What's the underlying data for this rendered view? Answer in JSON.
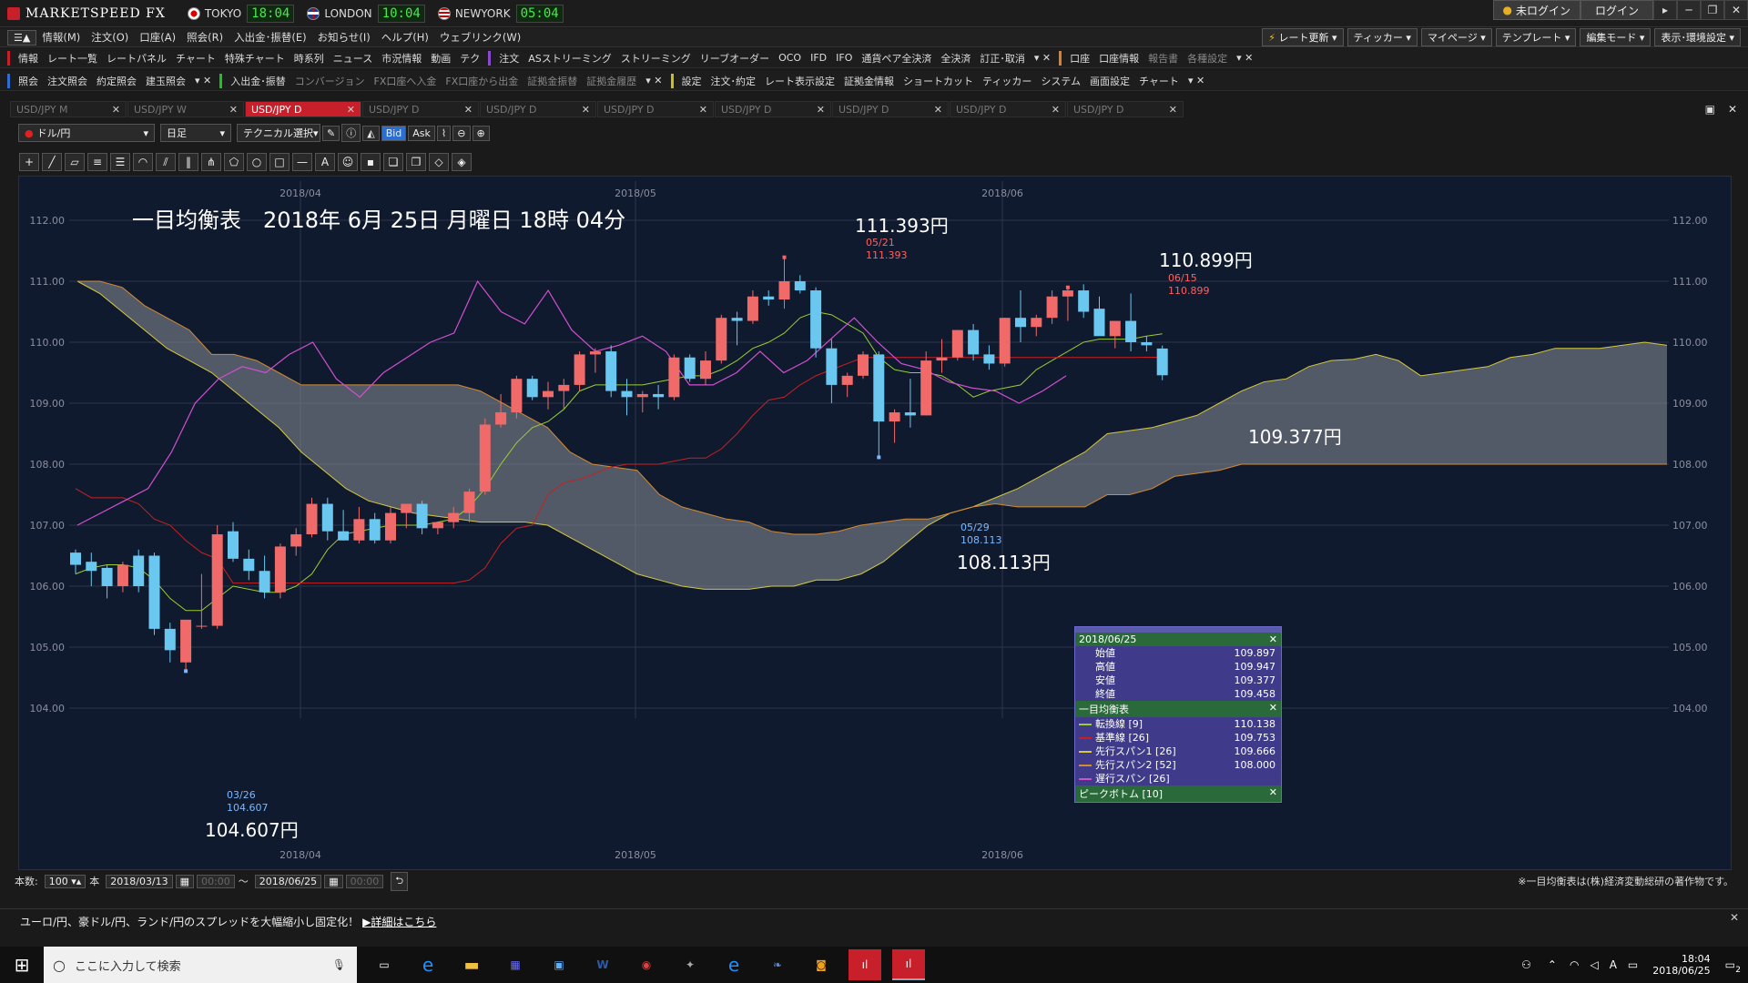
{
  "app": {
    "title": "MARKETSPEED FX",
    "brand_color": "#c8202a"
  },
  "clocks": [
    {
      "city": "TOKYO",
      "time": "18:04"
    },
    {
      "city": "LONDON",
      "time": "10:04"
    },
    {
      "city": "NEWYORK",
      "time": "05:04"
    }
  ],
  "top_buttons": {
    "login_status": "未ログイン",
    "login": "ログイン"
  },
  "menu": [
    "情報(M)",
    "注文(O)",
    "口座(A)",
    "照会(R)",
    "入出金･振替(E)",
    "お知らせ(I)",
    "ヘルプ(H)",
    "ウェブリンク(W)"
  ],
  "right_menu": [
    "レート更新",
    "ティッカー",
    "マイページ",
    "テンプレート",
    "編集モード",
    "表示･環境設定"
  ],
  "toolbar1": [
    "情報",
    "レート一覧",
    "レートパネル",
    "チャート",
    "特殊チャート",
    "時系列",
    "ニュース",
    "市況情報",
    "動画",
    "テク",
    "注文",
    "ASストリーミング",
    "ストリーミング",
    "リーブオーダー",
    "OCO",
    "IFD",
    "IFO",
    "通貨ペア全決済",
    "全決済",
    "訂正･取消",
    "口座",
    "口座情報",
    "報告書",
    "各種設定"
  ],
  "toolbar2": [
    "照会",
    "注文照会",
    "約定照会",
    "建玉照会",
    "入出金･振替",
    "コンバージョン",
    "FX口座へ入金",
    "FX口座から出金",
    "証拠金振替",
    "証拠金履歴",
    "設定",
    "注文･約定",
    "レート表示設定",
    "証拠金情報",
    "ショートカット",
    "ティッカー",
    "システム",
    "画面設定",
    "チャート"
  ],
  "tabs": [
    "USD/JPY M",
    "USD/JPY W",
    "USD/JPY D",
    "USD/JPY D",
    "USD/JPY D",
    "USD/JPY D",
    "USD/JPY D",
    "USD/JPY D",
    "USD/JPY D",
    "USD/JPY D"
  ],
  "active_tab": 2,
  "controls": {
    "pair": "ドル/円",
    "period": "日足",
    "technical": "テクニカル選択",
    "bid": "Bid",
    "ask": "Ask"
  },
  "chart_title": "一目均衡表　2018年 6月 25日 月曜日 18時 04分",
  "annotations": {
    "high1_big": "111.393円",
    "high1_date": "05/21",
    "high1_val": "111.393",
    "high2_big": "110.899円",
    "high2_date": "06/15",
    "high2_val": "110.899",
    "low1_big": "108.113円",
    "low1_date": "05/29",
    "low1_val": "108.113",
    "low0_big": "104.607円",
    "low0_date": "03/26",
    "low0_val": "104.607",
    "last_big": "109.377円"
  },
  "chart_data": {
    "type": "candlestick",
    "instrument": "USD/JPY",
    "timeframe": "daily",
    "ylim": [
      103.8,
      112.2
    ],
    "y_ticks": [
      "112.00",
      "111.00",
      "110.00",
      "109.00",
      "108.00",
      "107.00",
      "106.00",
      "105.00",
      "104.00"
    ],
    "x_ticks": [
      "2018/04",
      "2018/05",
      "2018/06"
    ],
    "candles": [
      [
        106.55,
        106.6,
        106.2,
        106.35
      ],
      [
        106.4,
        106.55,
        106.0,
        106.25
      ],
      [
        106.3,
        106.35,
        105.8,
        106.0
      ],
      [
        106.0,
        106.4,
        105.9,
        106.35
      ],
      [
        106.5,
        106.6,
        105.9,
        106.0
      ],
      [
        106.5,
        106.55,
        105.2,
        105.3
      ],
      [
        105.3,
        105.4,
        104.75,
        104.95
      ],
      [
        104.75,
        105.4,
        104.607,
        105.45
      ],
      [
        105.35,
        106.2,
        105.3,
        105.35
      ],
      [
        105.35,
        107.0,
        105.3,
        106.85
      ],
      [
        106.9,
        107.05,
        106.4,
        106.45
      ],
      [
        106.45,
        106.6,
        106.1,
        106.25
      ],
      [
        106.25,
        106.5,
        105.8,
        105.9
      ],
      [
        105.9,
        106.7,
        105.8,
        106.65
      ],
      [
        106.65,
        106.95,
        106.5,
        106.85
      ],
      [
        106.85,
        107.45,
        106.8,
        107.35
      ],
      [
        107.35,
        107.45,
        106.75,
        106.9
      ],
      [
        106.9,
        107.25,
        106.75,
        106.75
      ],
      [
        106.75,
        107.3,
        106.7,
        107.1
      ],
      [
        107.1,
        107.2,
        106.7,
        106.75
      ],
      [
        106.75,
        107.3,
        106.7,
        107.2
      ],
      [
        107.2,
        107.35,
        106.95,
        107.35
      ],
      [
        107.35,
        107.4,
        106.85,
        106.95
      ],
      [
        106.95,
        107.0,
        106.85,
        107.05
      ],
      [
        107.05,
        107.3,
        106.95,
        107.2
      ],
      [
        107.2,
        107.6,
        107.05,
        107.55
      ],
      [
        107.55,
        108.75,
        107.5,
        108.65
      ],
      [
        108.65,
        109.15,
        108.6,
        108.85
      ],
      [
        108.85,
        109.45,
        108.75,
        109.4
      ],
      [
        109.4,
        109.45,
        109.05,
        109.1
      ],
      [
        109.1,
        109.35,
        108.9,
        109.2
      ],
      [
        109.2,
        109.4,
        108.9,
        109.3
      ],
      [
        109.3,
        109.85,
        109.2,
        109.8
      ],
      [
        109.8,
        109.9,
        109.5,
        109.85
      ],
      [
        109.85,
        109.95,
        109.1,
        109.2
      ],
      [
        109.2,
        109.4,
        108.8,
        109.1
      ],
      [
        109.1,
        109.2,
        108.85,
        109.15
      ],
      [
        109.15,
        109.3,
        108.9,
        109.1
      ],
      [
        109.1,
        109.8,
        109.05,
        109.75
      ],
      [
        109.75,
        109.8,
        109.35,
        109.4
      ],
      [
        109.4,
        109.85,
        109.3,
        109.7
      ],
      [
        109.7,
        110.45,
        109.65,
        110.4
      ],
      [
        110.4,
        110.5,
        109.95,
        110.35
      ],
      [
        110.35,
        110.85,
        110.3,
        110.75
      ],
      [
        110.75,
        110.85,
        110.6,
        110.7
      ],
      [
        110.7,
        111.393,
        110.55,
        111.0
      ],
      [
        111.0,
        111.1,
        110.8,
        110.85
      ],
      [
        110.85,
        110.9,
        109.75,
        109.9
      ],
      [
        109.9,
        110.05,
        109.0,
        109.3
      ],
      [
        109.3,
        109.5,
        109.1,
        109.45
      ],
      [
        109.45,
        109.85,
        109.4,
        109.8
      ],
      [
        109.8,
        109.85,
        108.113,
        108.7
      ],
      [
        108.7,
        108.9,
        108.35,
        108.85
      ],
      [
        108.85,
        109.4,
        108.6,
        108.8
      ],
      [
        108.8,
        109.85,
        108.8,
        109.7
      ],
      [
        109.7,
        110.05,
        109.5,
        109.75
      ],
      [
        109.75,
        110.2,
        109.7,
        110.2
      ],
      [
        110.2,
        110.3,
        109.7,
        109.8
      ],
      [
        109.8,
        109.95,
        109.55,
        109.65
      ],
      [
        109.65,
        110.4,
        109.6,
        110.4
      ],
      [
        110.4,
        110.85,
        110.0,
        110.25
      ],
      [
        110.25,
        110.45,
        110.1,
        110.4
      ],
      [
        110.4,
        110.85,
        110.3,
        110.75
      ],
      [
        110.75,
        110.899,
        110.35,
        110.85
      ],
      [
        110.85,
        110.95,
        110.4,
        110.5
      ],
      [
        110.55,
        110.75,
        110.15,
        110.1
      ],
      [
        110.1,
        110.35,
        109.9,
        110.35
      ],
      [
        110.35,
        110.8,
        109.85,
        110.0
      ],
      [
        110.0,
        110.1,
        109.85,
        109.95
      ],
      [
        109.897,
        109.947,
        109.377,
        109.458
      ]
    ],
    "series": [
      {
        "name": "転換線 [9]",
        "color": "#9acd32",
        "values": [
          106.2,
          106.3,
          106.35,
          106.35,
          106.3,
          106.1,
          105.8,
          105.6,
          105.6,
          105.8,
          106.0,
          105.95,
          105.9,
          105.9,
          106.0,
          106.2,
          106.6,
          106.85,
          106.9,
          106.95,
          107.0,
          107.0,
          107.0,
          107.05,
          107.1,
          107.3,
          107.6,
          108.0,
          108.35,
          108.6,
          108.7,
          108.9,
          109.2,
          109.3,
          109.3,
          109.3,
          109.3,
          109.35,
          109.4,
          109.45,
          109.45,
          109.55,
          109.7,
          109.9,
          110.0,
          110.15,
          110.4,
          110.5,
          110.45,
          110.3,
          110.15,
          109.75,
          109.55,
          109.5,
          109.5,
          109.45,
          109.3,
          109.1,
          109.2,
          109.25,
          109.3,
          109.55,
          109.7,
          109.85,
          110.0,
          110.05,
          110.05,
          110.05,
          110.1,
          110.138
        ]
      },
      {
        "name": "基準線 [26]",
        "color": "#c82020",
        "values": [
          107.6,
          107.45,
          107.45,
          107.45,
          107.35,
          107.1,
          107.0,
          106.75,
          106.55,
          106.45,
          106.05,
          106.05,
          106.05,
          106.05,
          106.05,
          106.05,
          106.05,
          106.05,
          106.05,
          106.05,
          106.05,
          106.05,
          106.05,
          106.05,
          106.05,
          106.1,
          106.3,
          106.7,
          106.95,
          107.0,
          107.5,
          107.7,
          107.75,
          107.85,
          107.95,
          108.0,
          108.0,
          108.0,
          108.05,
          108.1,
          108.1,
          108.25,
          108.5,
          108.8,
          109.05,
          109.1,
          109.3,
          109.45,
          109.55,
          109.65,
          109.75,
          109.75,
          109.75,
          109.75,
          109.75,
          109.75,
          109.75,
          109.75,
          109.75,
          109.75,
          109.75,
          109.75,
          109.75,
          109.75,
          109.75,
          109.75,
          109.75,
          109.75,
          109.753,
          109.753
        ]
      },
      {
        "name": "先行スパン1 [26]",
        "color": "#d4c840",
        "offset": 0,
        "values": [
          111.0,
          110.8,
          110.5,
          110.2,
          109.9,
          109.7,
          109.5,
          109.2,
          108.9,
          108.6,
          108.2,
          107.9,
          107.6,
          107.4,
          107.3,
          107.2,
          107.15,
          107.1,
          107.05,
          107.05,
          107.05,
          107.0,
          106.8,
          106.6,
          106.4,
          106.2,
          106.1,
          106.0,
          105.95,
          105.95,
          105.95,
          106.0,
          106.0,
          106.1,
          106.1,
          106.2,
          106.4,
          106.7,
          107.0,
          107.2,
          107.3,
          107.45,
          107.6,
          107.8,
          108.0,
          108.2,
          108.5,
          108.55,
          108.6,
          108.7,
          108.8,
          109.0,
          109.2,
          109.35,
          109.4,
          109.6,
          109.7,
          109.72,
          109.8,
          109.7,
          109.45,
          109.5,
          109.55,
          109.6,
          109.75,
          109.8,
          109.9,
          109.9,
          109.9,
          109.95,
          110.0,
          109.95
        ]
      },
      {
        "name": "先行スパン2 [52]",
        "color": "#d48a30",
        "offset": 0,
        "values": [
          111.0,
          111.0,
          110.9,
          110.6,
          110.4,
          110.2,
          109.8,
          109.8,
          109.7,
          109.5,
          109.3,
          109.3,
          109.3,
          109.3,
          109.3,
          109.3,
          109.3,
          109.3,
          109.2,
          109.0,
          108.8,
          108.6,
          108.2,
          108.0,
          107.95,
          107.9,
          107.5,
          107.3,
          107.2,
          107.1,
          107.05,
          106.9,
          106.85,
          106.85,
          106.9,
          107.0,
          107.05,
          107.1,
          107.1,
          107.2,
          107.3,
          107.35,
          107.3,
          107.3,
          107.3,
          107.3,
          107.5,
          107.5,
          107.6,
          107.8,
          107.85,
          107.9,
          108.0,
          108.0,
          108.0,
          108.0,
          108.0,
          108.0,
          108.0,
          108.0,
          108.0,
          108.0,
          108.0,
          108.0,
          108.0,
          108.0,
          108.0,
          108.0,
          108.0,
          108.0,
          108.0,
          108.0
        ]
      },
      {
        "name": "遅行スパン [26]",
        "color": "#d050d0",
        "values": [
          107.0,
          107.2,
          107.4,
          107.6,
          108.2,
          109.0,
          109.4,
          109.6,
          109.5,
          109.8,
          110.0,
          109.4,
          109.1,
          109.5,
          109.75,
          110.0,
          110.15,
          111.0,
          110.5,
          110.3,
          110.85,
          110.2,
          109.85,
          109.95,
          110.1,
          109.85,
          109.3,
          109.3,
          109.5,
          109.85,
          109.5,
          109.7,
          110.05,
          110.4,
          110.0,
          109.65,
          109.55,
          109.35,
          109.25,
          109.2,
          109.0,
          109.2,
          109.45
        ]
      }
    ]
  },
  "info_panel": {
    "date": "2018/06/25",
    "ohlc": [
      {
        "k": "始値",
        "v": "109.897"
      },
      {
        "k": "高値",
        "v": "109.947"
      },
      {
        "k": "安値",
        "v": "109.377"
      },
      {
        "k": "終値",
        "v": "109.458"
      }
    ],
    "ichimoku_title": "一目均衡表",
    "ichimoku": [
      {
        "k": "転換線 [9]",
        "v": "110.138",
        "c": "#9acd32"
      },
      {
        "k": "基準線 [26]",
        "v": "109.753",
        "c": "#c82020"
      },
      {
        "k": "先行スパン1 [26]",
        "v": "109.666",
        "c": "#d4c840"
      },
      {
        "k": "先行スパン2 [52]",
        "v": "108.000",
        "c": "#d48a30"
      },
      {
        "k": "遅行スパン [26]",
        "v": "",
        "c": "#d050d0"
      }
    ],
    "peak_title": "ピークボトム [10]"
  },
  "bottom": {
    "count_label": "本数:",
    "count": "100",
    "unit": "本",
    "from": "2018/03/13",
    "from_time": "00:00",
    "tilde": "～",
    "to": "2018/06/25",
    "to_time": "00:00",
    "copyright": "※一目均衡表は(株)経済変動総研の著作物です。"
  },
  "news": {
    "text": "ユーロ/円、豪ドル/円、ランド/円のスプレッドを大幅縮小し固定化！",
    "link": "詳細はこちら"
  },
  "taskbar": {
    "search_placeholder": "ここに入力して検索",
    "time": "18:04",
    "date": "2018/06/25",
    "notification_count": "2"
  },
  "colors": {
    "bull": "#f06a6a",
    "bear": "#6ac8f0",
    "background": "#101a2e"
  }
}
